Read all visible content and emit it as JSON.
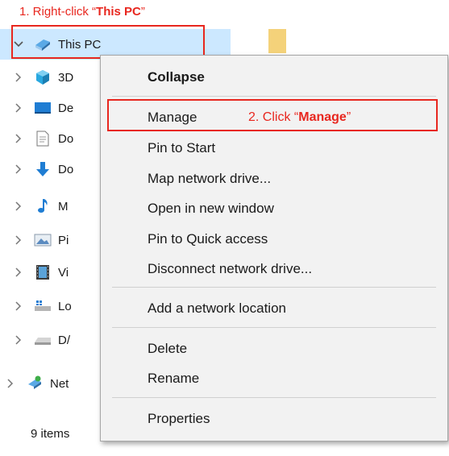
{
  "annotations": {
    "step1_prefix": "1. Right-click “",
    "step1_target": "This PC",
    "step1_suffix": "”",
    "step2_prefix": "2.  Click “",
    "step2_target": "Manage",
    "step2_suffix": "”",
    "highlight_color": "#e8271f"
  },
  "nav": {
    "selected_color": "#cce8ff",
    "this_pc": {
      "label": "This PC",
      "icon": "computer-icon"
    },
    "items": [
      {
        "label": "3D",
        "icon": "3d-objects-icon"
      },
      {
        "label": "De",
        "icon": "desktop-icon"
      },
      {
        "label": "Do",
        "icon": "documents-icon"
      },
      {
        "label": "Do",
        "icon": "downloads-icon"
      },
      {
        "label": "M",
        "icon": "music-icon"
      },
      {
        "label": "Pi",
        "icon": "pictures-icon"
      },
      {
        "label": "Vi",
        "icon": "videos-icon"
      },
      {
        "label": "Lo",
        "icon": "local-disk-icon"
      },
      {
        "label": "D/",
        "icon": "drive-icon"
      }
    ],
    "network": {
      "label": "Net",
      "icon": "network-icon"
    }
  },
  "status": {
    "items_count": "9 items"
  },
  "menu": {
    "collapse": "Collapse",
    "manage": "Manage",
    "pin_start": "Pin to Start",
    "map_drive": "Map network drive...",
    "open_window": "Open in new window",
    "pin_quick": "Pin to Quick access",
    "disconnect": "Disconnect network drive...",
    "add_location": "Add a network location",
    "delete": "Delete",
    "rename": "Rename",
    "properties": "Properties"
  }
}
